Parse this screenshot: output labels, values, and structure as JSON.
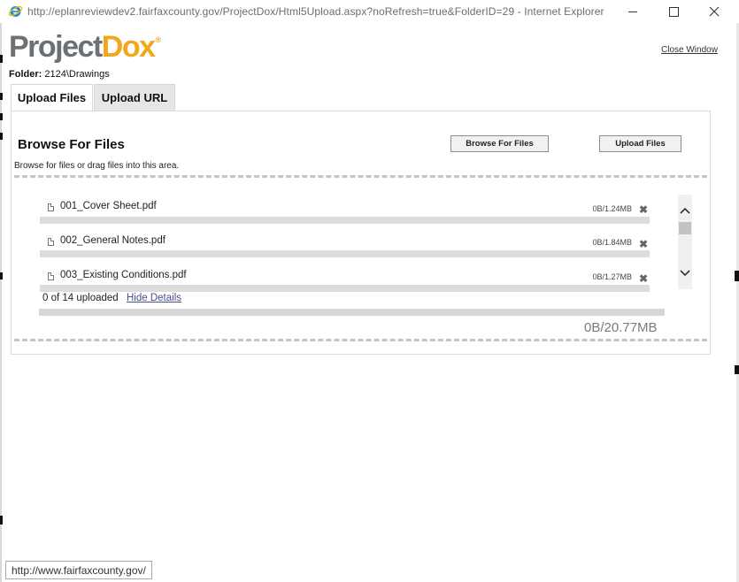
{
  "window": {
    "title": "http://eplanreviewdev2.fairfaxcounty.gov/ProjectDox/Html5Upload.aspx?noRefresh=true&FolderID=29 - Internet Explorer"
  },
  "logo": {
    "part1": "Project",
    "part2": "Dox",
    "reg": "®"
  },
  "header": {
    "close_window": "Close Window",
    "folder_label": "Folder:",
    "folder_value": "2124\\Drawings"
  },
  "tabs": [
    {
      "label": "Upload Files",
      "active": true
    },
    {
      "label": "Upload URL",
      "active": false
    }
  ],
  "browse": {
    "title": "Browse For Files",
    "hint": "Browse for files or drag files into this area.",
    "browse_button": "Browse For Files",
    "upload_button": "Upload Files"
  },
  "files": [
    {
      "name": "001_Cover Sheet.pdf",
      "size": "0B/1.24MB"
    },
    {
      "name": "002_General Notes.pdf",
      "size": "0B/1.84MB"
    },
    {
      "name": "003_Existing Conditions.pdf",
      "size": "0B/1.27MB"
    }
  ],
  "summary": {
    "count_text": "0 of 14 uploaded",
    "hide_details": "Hide Details",
    "total": "0B/20.77MB"
  },
  "statusbar": {
    "url": "http://www.fairfaxcounty.gov/"
  },
  "colors": {
    "accent_orange": "#f2a71a",
    "logo_gray": "#6b7075",
    "link": "#4a4e8c"
  }
}
